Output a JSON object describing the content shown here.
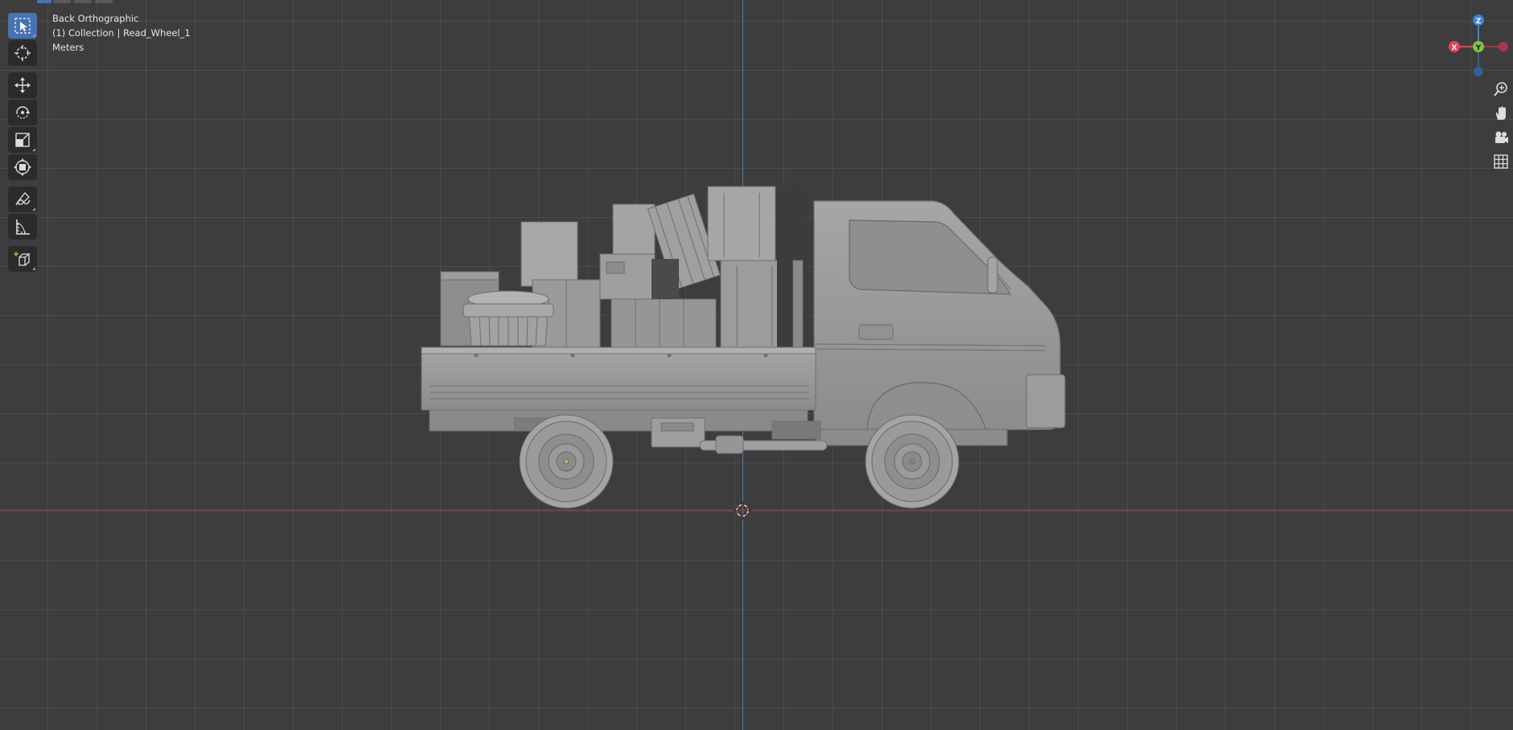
{
  "viewport": {
    "view_name": "Back Orthographic",
    "collection_info": "(1) Collection | Read_Wheel_1",
    "units": "Meters"
  },
  "toolbar": {
    "tools": [
      {
        "name": "select-box",
        "icon": "select-box-icon",
        "active": true
      },
      {
        "name": "cursor",
        "icon": "cursor-icon",
        "active": false
      },
      {
        "name": "move",
        "icon": "move-icon",
        "active": false
      },
      {
        "name": "rotate",
        "icon": "rotate-icon",
        "active": false
      },
      {
        "name": "scale",
        "icon": "scale-icon",
        "active": false
      },
      {
        "name": "transform",
        "icon": "transform-icon",
        "active": false
      },
      {
        "name": "annotate",
        "icon": "annotate-icon",
        "active": false
      },
      {
        "name": "measure",
        "icon": "measure-icon",
        "active": false
      },
      {
        "name": "add-cube",
        "icon": "add-cube-icon",
        "active": false
      }
    ]
  },
  "gizmo": {
    "x_label": "X",
    "y_label": "Y",
    "z_label": "Z",
    "colors": {
      "x": "#e8425a",
      "y": "#7fc638",
      "z": "#3b84d6",
      "x_neg": "#a8394a",
      "z_neg": "#345f94"
    }
  },
  "navigation": {
    "buttons": [
      "zoom-icon",
      "hand-icon",
      "camera-icon",
      "grid-icon"
    ]
  },
  "colors": {
    "background": "#3d3d3d",
    "x_axis": "#a84848",
    "z_axis": "#4a7fb5",
    "active_tool": "#4772b3",
    "model": "#9a9a9a"
  }
}
